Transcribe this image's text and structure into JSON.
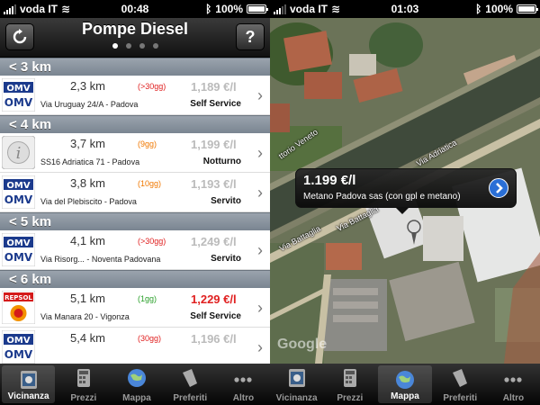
{
  "left_screen": {
    "status": {
      "carrier": "voda IT",
      "time": "00:48",
      "battery": "100%"
    },
    "nav": {
      "title": "Pompe Diesel"
    },
    "sections": [
      {
        "label": "< 3 km",
        "rows": [
          {
            "brand": "OMV",
            "distance": "2,3 km",
            "days": "(>30gg)",
            "days_color": "#e02020",
            "price": "1,189 €/l",
            "price_highlight": false,
            "address": "Via Uruguay 24/A - Padova",
            "service": "Self Service"
          }
        ]
      },
      {
        "label": "< 4 km",
        "rows": [
          {
            "brand": "info",
            "distance": "3,7 km",
            "days": "(9gg)",
            "days_color": "#f07800",
            "price": "1,199 €/l",
            "price_highlight": false,
            "address": "SS16 Adriatica 71 - Padova",
            "service": "Notturno"
          },
          {
            "brand": "OMV",
            "distance": "3,8 km",
            "days": "(10gg)",
            "days_color": "#f07800",
            "price": "1,193 €/l",
            "price_highlight": false,
            "address": "Via del Plebiscito - Padova",
            "service": "Servito"
          }
        ]
      },
      {
        "label": "< 5 km",
        "rows": [
          {
            "brand": "OMV",
            "distance": "4,1 km",
            "days": "(>30gg)",
            "days_color": "#e02020",
            "price": "1,249 €/l",
            "price_highlight": false,
            "address": "Via Risorg... - Noventa Padovana",
            "service": "Servito"
          }
        ]
      },
      {
        "label": "< 6 km",
        "rows": [
          {
            "brand": "REPSOL",
            "distance": "5,1 km",
            "days": "(1gg)",
            "days_color": "#2aa02a",
            "price": "1,229 €/l",
            "price_highlight": true,
            "address": "Via Manara 20 - Vigonza",
            "service": "Self Service"
          },
          {
            "brand": "OMV",
            "distance": "5,4 km",
            "days": "(30gg)",
            "days_color": "#e02020",
            "price": "1,196 €/l",
            "price_highlight": false,
            "address": "",
            "service": ""
          }
        ]
      }
    ],
    "tabs": [
      {
        "label": "Vicinanza",
        "icon": "compass-screen-icon",
        "active": true
      },
      {
        "label": "Prezzi",
        "icon": "calculator-icon",
        "active": false
      },
      {
        "label": "Mappa",
        "icon": "globe-icon",
        "active": false
      },
      {
        "label": "Preferiti",
        "icon": "bookmark-icon",
        "active": false
      },
      {
        "label": "Altro",
        "icon": "more-dots-icon",
        "active": false
      }
    ]
  },
  "right_screen": {
    "status": {
      "carrier": "voda IT",
      "time": "01:03",
      "battery": "100%"
    },
    "callout": {
      "price": "1.199 €/l",
      "name": "Metano Padova sas (con gpl e metano)"
    },
    "road_labels": [
      "Via Adriatica",
      "Via Battaglia",
      "Via Battaglia",
      "ttorio Veneto"
    ],
    "watermark": "Google",
    "tabs": [
      {
        "label": "Vicinanza",
        "icon": "compass-screen-icon",
        "active": false
      },
      {
        "label": "Prezzi",
        "icon": "calculator-icon",
        "active": false
      },
      {
        "label": "Mappa",
        "icon": "globe-icon",
        "active": true
      },
      {
        "label": "Preferiti",
        "icon": "bookmark-icon",
        "active": false
      },
      {
        "label": "Altro",
        "icon": "more-dots-icon",
        "active": false
      }
    ]
  }
}
